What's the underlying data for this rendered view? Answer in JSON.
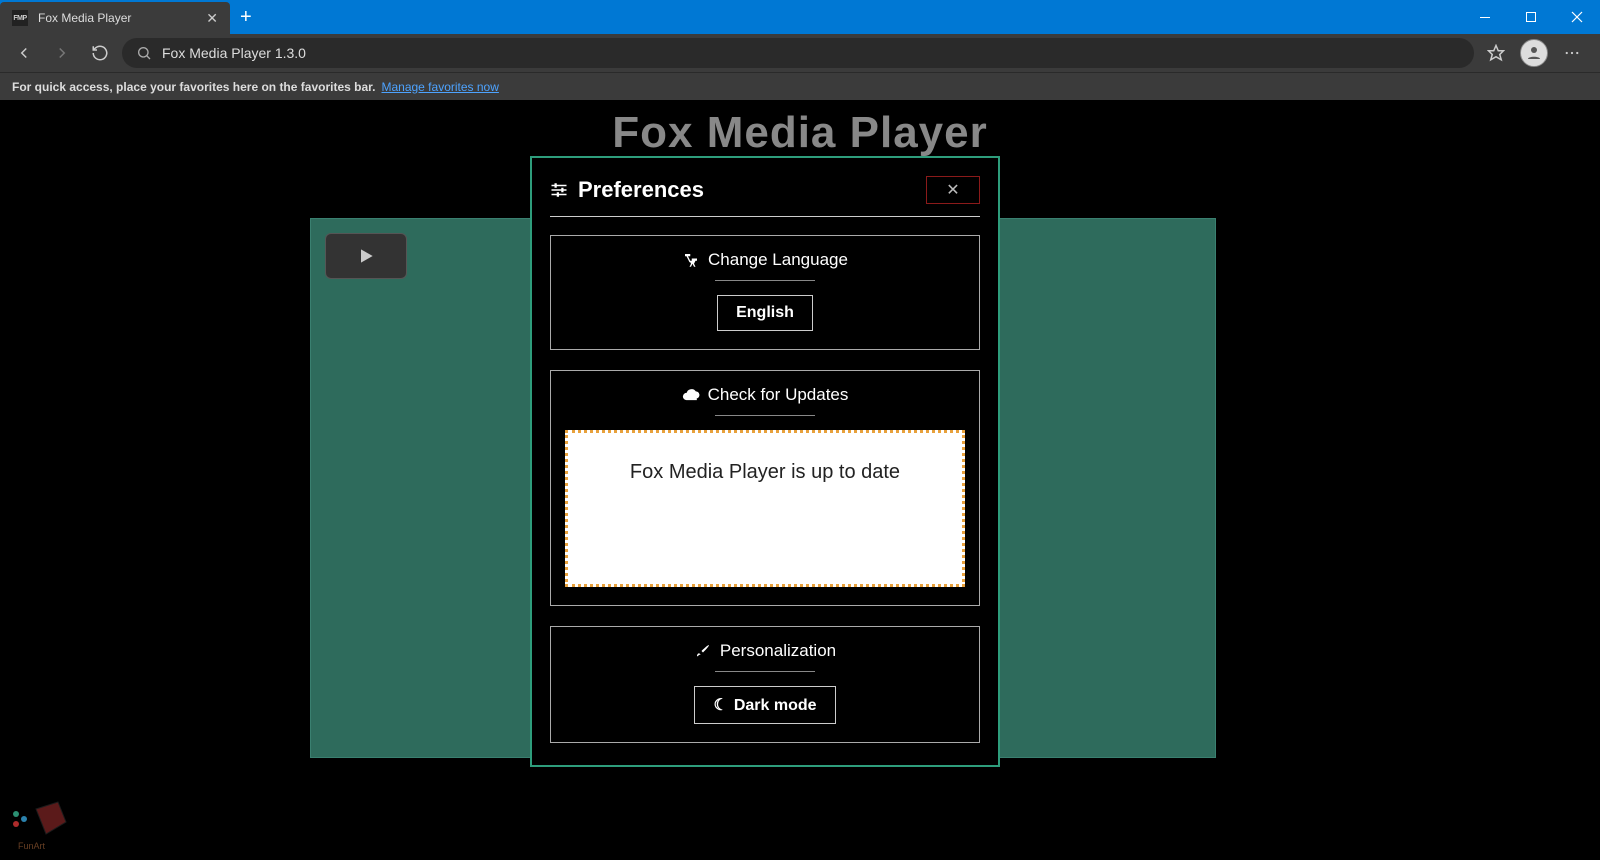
{
  "browser": {
    "tab_title": "Fox Media Player",
    "tab_icon_text": "FMP",
    "address": "Fox Media Player 1.3.0",
    "favorites_hint": "For quick access, place your favorites here on the favorites bar.",
    "favorites_link": "Manage favorites now"
  },
  "app": {
    "title": "Fox Media Player"
  },
  "modal": {
    "title": "Preferences",
    "close_glyph": "✕",
    "language": {
      "heading": "Change Language",
      "current": "English"
    },
    "updates": {
      "heading": "Check for Updates",
      "status": "Fox Media Player is up to date"
    },
    "personalization": {
      "heading": "Personalization",
      "mode_label": "Dark mode"
    }
  }
}
